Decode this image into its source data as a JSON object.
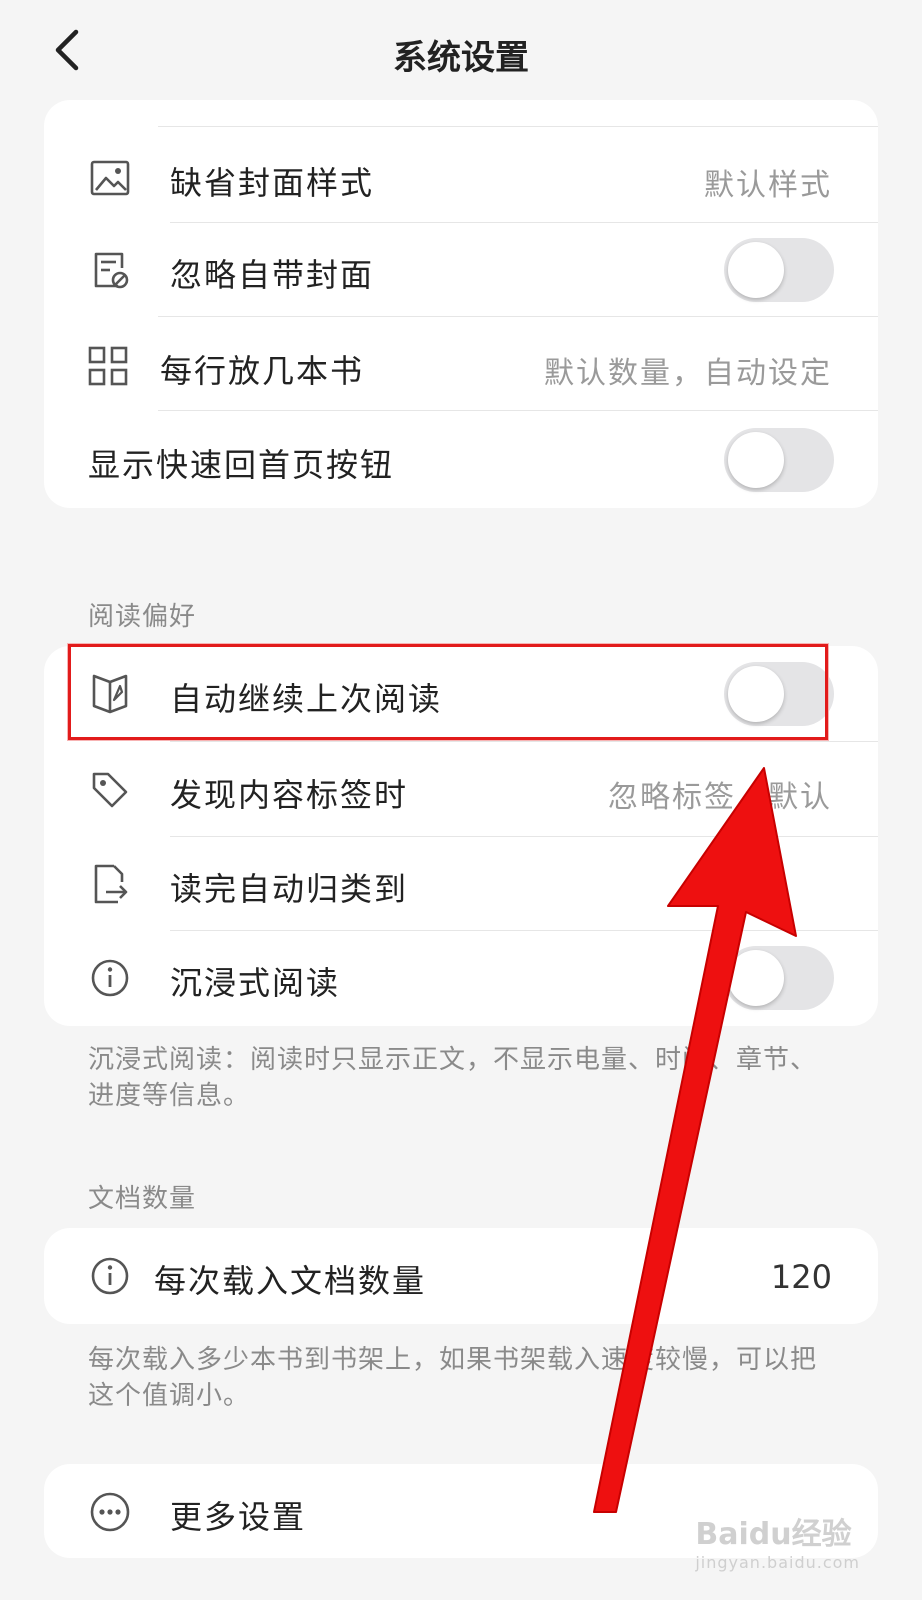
{
  "header": {
    "title": "系统设置"
  },
  "display_card": {
    "rows": [
      {
        "label": "缺省封面样式",
        "value": "默认样式",
        "icon": "image-icon"
      },
      {
        "label": "忽略自带封面",
        "toggle": false,
        "icon": "document-no-icon"
      },
      {
        "label": "每行放几本书",
        "value": "默认数量，自动设定",
        "icon": "grid-icon"
      },
      {
        "label": "显示快速回首页按钮",
        "toggle": false
      }
    ]
  },
  "reading": {
    "section_title": "阅读偏好",
    "rows": [
      {
        "label": "自动继续上次阅读",
        "toggle": false,
        "icon": "book-icon"
      },
      {
        "label": "发现内容标签时",
        "value": "忽略标签，默认",
        "icon": "tag-icon"
      },
      {
        "label": "读完自动归类到",
        "icon": "file-export-icon"
      },
      {
        "label": "沉浸式阅读",
        "toggle": false,
        "icon": "info-icon"
      }
    ],
    "note": "沉浸式阅读：阅读时只显示正文，不显示电量、时间、章节、进度等信息。"
  },
  "documents": {
    "section_title": "文档数量",
    "row": {
      "label": "每次载入文档数量",
      "value": "120",
      "icon": "info-icon"
    },
    "note": "每次载入多少本书到书架上，如果书架载入速度较慢，可以把这个值调小。"
  },
  "more": {
    "label": "更多设置",
    "icon": "more-icon"
  },
  "watermark": {
    "main": "Baidu经验",
    "sub": "jingyan.baidu.com"
  },
  "colors": {
    "annotation_red": "#e21b1b",
    "toggle_off": "#e4e4e6"
  }
}
